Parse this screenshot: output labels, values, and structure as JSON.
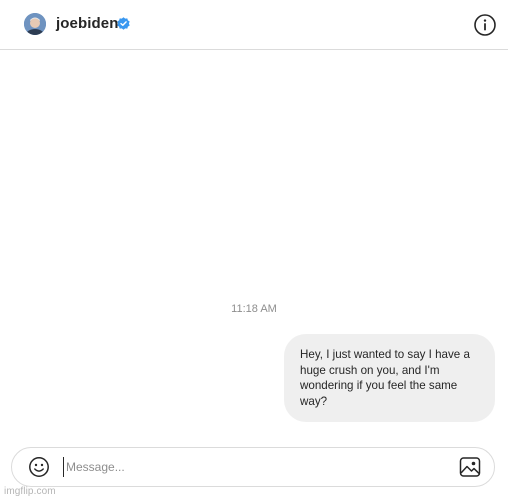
{
  "header": {
    "username": "joebiden",
    "verified_icon": "verified-badge-icon",
    "info_icon": "info-icon"
  },
  "conversation": {
    "timestamp": "11:18 AM",
    "messages": [
      {
        "sender": "me",
        "text": "Hey, I just wanted to say I have a huge crush on you, and I'm wondering if you feel the same way?"
      }
    ]
  },
  "composer": {
    "placeholder": "Message...",
    "value": "",
    "emoji_icon": "emoji-icon",
    "image_icon": "image-icon"
  },
  "watermark": "imgflip.com",
  "colors": {
    "accent_verified": "#3897f0",
    "bubble_bg": "#efefef",
    "border": "#dbdbdb",
    "muted_text": "#8e8e8e"
  }
}
